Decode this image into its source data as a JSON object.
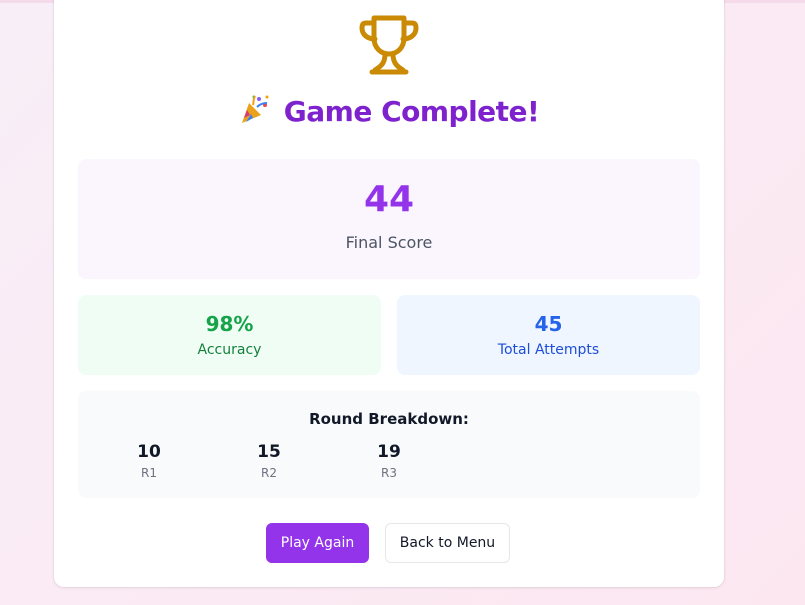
{
  "colors": {
    "accent": "#9333ea",
    "title": "#7e22ce",
    "trophy": "#ca8a04",
    "accuracy": "#16a34a",
    "attempts": "#2563eb"
  },
  "header": {
    "trophy_icon": "trophy-icon",
    "party_icon": "party-popper-icon",
    "title": "Game Complete!"
  },
  "score": {
    "value": "44",
    "label": "Final Score"
  },
  "stats": {
    "accuracy": {
      "value": "98%",
      "label": "Accuracy"
    },
    "attempts": {
      "value": "45",
      "label": "Total Attempts"
    }
  },
  "rounds": {
    "title": "Round Breakdown:",
    "items": [
      {
        "value": "10",
        "label": "R1"
      },
      {
        "value": "15",
        "label": "R2"
      },
      {
        "value": "19",
        "label": "R3"
      }
    ]
  },
  "actions": {
    "play_again": "Play Again",
    "back_to_menu": "Back to Menu"
  }
}
